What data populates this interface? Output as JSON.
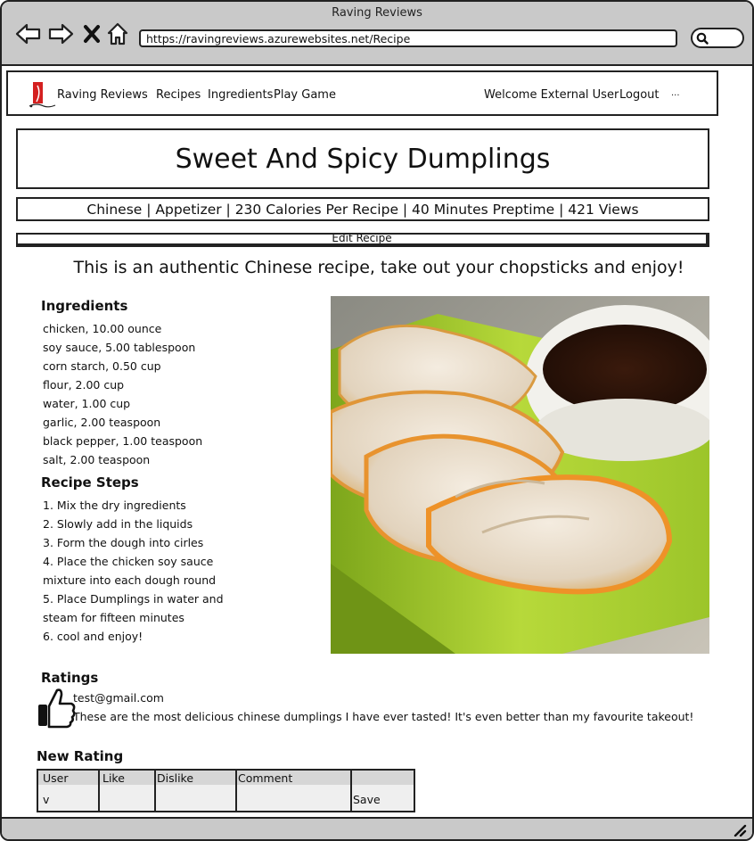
{
  "browser": {
    "window_title": "Raving Reviews",
    "url": "https://ravingreviews.azurewebsites.net/Recipe"
  },
  "nav": {
    "brand": "Raving Reviews",
    "links": [
      "Recipes",
      "Ingredients",
      "Play Game"
    ],
    "welcome": "Welcome External User",
    "logout": "Logout",
    "more": "..."
  },
  "recipe": {
    "title": "Sweet And Spicy Dumplings",
    "meta": "Chinese | Appetizer | 230 Calories Per Recipe | 40 Minutes Preptime | 421 Views",
    "edit_label": "Edit Recipe",
    "description": "This is an authentic Chinese recipe, take out your chopsticks and enjoy!"
  },
  "ingredients": {
    "heading": "Ingredients",
    "items": [
      "chicken, 10.00 ounce",
      "soy sauce, 5.00 tablespoon",
      "corn starch, 0.50 cup",
      "flour, 2.00 cup",
      "water, 1.00 cup",
      "garlic, 2.00 teaspoon",
      "black pepper, 1.00 teaspoon",
      "salt, 2.00 teaspoon"
    ]
  },
  "steps": {
    "heading": "Recipe Steps",
    "lines": [
      "1. Mix the dry ingredients",
      "2. Slowly add in the liquids",
      "3. Form the dough into cirles",
      "4. Place the chicken soy sauce",
      "mixture into each dough round",
      "5. Place Dumplings in water and",
      "steam for fifteen minutes",
      "6. cool and enjoy!"
    ]
  },
  "ratings": {
    "heading": "Ratings",
    "entries": [
      {
        "user": "test@gmail.com",
        "comment": "These are the most delicious chinese dumplings I have ever tasted! It's even better than my favourite takeout!",
        "icon": "thumbs-up-icon"
      }
    ]
  },
  "new_rating": {
    "heading": "New Rating",
    "columns": [
      "User",
      "Like",
      "Dislike",
      "Comment",
      ""
    ],
    "values": {
      "user": "v",
      "save": "Save"
    }
  },
  "icons": {
    "back": "arrow-left-icon",
    "forward": "arrow-right-icon",
    "stop": "close-icon",
    "home": "home-icon",
    "search": "search-icon",
    "logo": "chili-pepper-logo",
    "photo": "dumplings-photo",
    "resize": "resize-grip-icon"
  },
  "colors": {
    "chrome": "#c9c9c9",
    "logo_red": "#d42020",
    "header_row": "#d6d6d6",
    "input_row": "#efefef"
  }
}
